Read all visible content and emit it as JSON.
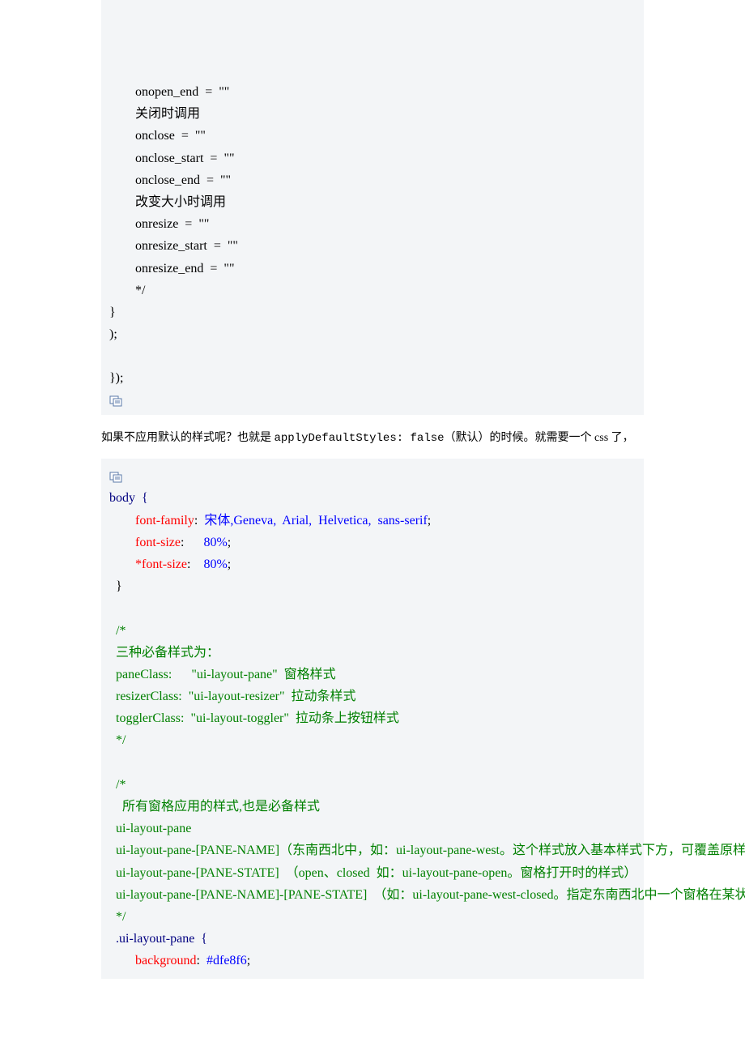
{
  "block1": {
    "l1": "        onopen_end  =  \"\"",
    "l2": "        关闭时调用",
    "l3": "        onclose  =  \"\"",
    "l4": "        onclose_start  =  \"\"",
    "l5": "        onclose_end  =  \"\"",
    "l6": "        改变大小时调用",
    "l7": "        onresize  =  \"\"",
    "l8": "        onresize_start  =  \"\"",
    "l9": "        onresize_end  =  \"\"",
    "l10": "        */",
    "l11": "}",
    "l12": ");",
    "l13": "",
    "l14": "});"
  },
  "intertext": {
    "pre": "如果不应用默认的样式呢？也就是 ",
    "mono": "applyDefaultStyles: false",
    "post": "（默认）的时候。就需要一个 css 了，"
  },
  "block2": {
    "body_sel": "body  {",
    "ff_prop": "        font-family",
    "ff_sep": ":  ",
    "ff_val": "宋体,Geneva,  Arial,  Helvetica,  sans-serif",
    "ff_end": ";",
    "fs_prop": "        font-size",
    "fs_sep": ":      ",
    "fs_val": "80%",
    "fs_end": ";",
    "fs2_prop": "        *font-size",
    "fs2_sep": ":    ",
    "fs2_val": "80%",
    "fs2_end": ";",
    "close1": "  }",
    "c1a": "  /*",
    "c1b": "  三种必备样式为：",
    "c1c": "  paneClass:      \"ui-layout-pane\"  窗格样式",
    "c1d": "  resizerClass:  \"ui-layout-resizer\"  拉动条样式",
    "c1e": "  togglerClass:  \"ui-layout-toggler\"  拉动条上按钮样式",
    "c1f": "  */",
    "c2a": "  /*",
    "c2b": "    所有窗格应用的样式,也是必备样式",
    "c2c": "  ui-layout-pane",
    "c2d": "  ui-layout-pane-[PANE-NAME]（东南西北中，如：ui-layout-pane-west。这个样式放入基本样式下方，可覆盖原样式。 ）",
    "c2e": "  ui-layout-pane-[PANE-STATE]  （open、closed  如：ui-layout-pane-open。窗格打开时的样式）",
    "c2f": "  ui-layout-pane-[PANE-NAME]-[PANE-STATE]  （如：ui-layout-pane-west-closed。指定东南西北中一个窗格在某状态下的样式。）",
    "c2g": "  */",
    "sel2": "  .ui-layout-pane  {",
    "bg_prop": "        background",
    "bg_sep": ":  ",
    "bg_val": "#dfe8f6",
    "bg_end": ";"
  }
}
